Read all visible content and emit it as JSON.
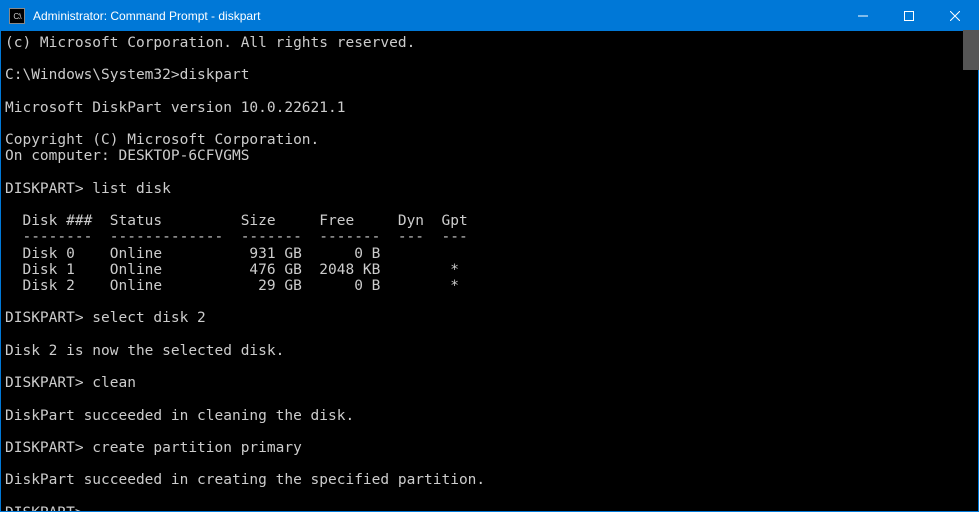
{
  "titlebar": {
    "icon_text": "C:\\",
    "title": "Administrator: Command Prompt - diskpart"
  },
  "terminal": {
    "lines": [
      "(c) Microsoft Corporation. All rights reserved.",
      "",
      "C:\\Windows\\System32>diskpart",
      "",
      "Microsoft DiskPart version 10.0.22621.1",
      "",
      "Copyright (C) Microsoft Corporation.",
      "On computer: DESKTOP-6CFVGMS",
      "",
      "DISKPART> list disk",
      "",
      "  Disk ###  Status         Size     Free     Dyn  Gpt",
      "  --------  -------------  -------  -------  ---  ---",
      "  Disk 0    Online          931 GB      0 B",
      "  Disk 1    Online          476 GB  2048 KB        *",
      "  Disk 2    Online           29 GB      0 B        *",
      "",
      "DISKPART> select disk 2",
      "",
      "Disk 2 is now the selected disk.",
      "",
      "DISKPART> clean",
      "",
      "DiskPart succeeded in cleaning the disk.",
      "",
      "DISKPART> create partition primary",
      "",
      "DiskPart succeeded in creating the specified partition.",
      "",
      "DISKPART>"
    ]
  },
  "chart_data": {
    "type": "table",
    "title": "list disk",
    "columns": [
      "Disk ###",
      "Status",
      "Size",
      "Free",
      "Dyn",
      "Gpt"
    ],
    "rows": [
      {
        "Disk ###": "Disk 0",
        "Status": "Online",
        "Size": "931 GB",
        "Free": "0 B",
        "Dyn": "",
        "Gpt": ""
      },
      {
        "Disk ###": "Disk 1",
        "Status": "Online",
        "Size": "476 GB",
        "Free": "2048 KB",
        "Dyn": "",
        "Gpt": "*"
      },
      {
        "Disk ###": "Disk 2",
        "Status": "Online",
        "Size": "29 GB",
        "Free": "0 B",
        "Dyn": "",
        "Gpt": "*"
      }
    ]
  }
}
